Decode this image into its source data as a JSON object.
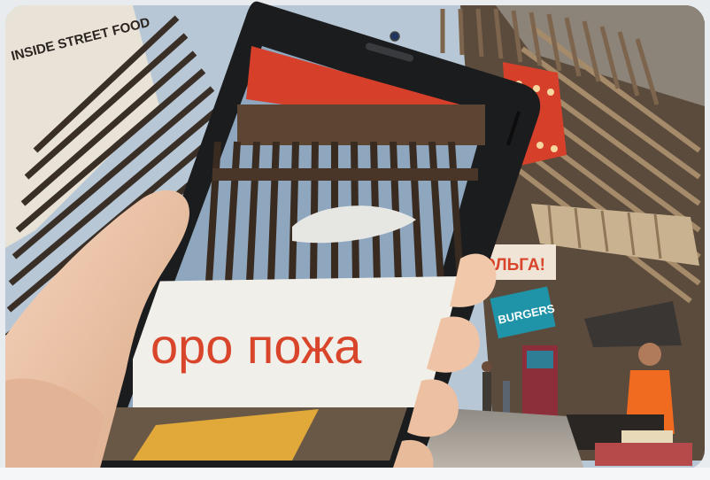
{
  "scene": {
    "subject": "hand holding smartphone in front of street food market entrance",
    "colors": {
      "wood_dark": "#3c3129",
      "wood_light": "#a78d6c",
      "sky": "#b7c7d6",
      "accent_red": "#d6402b",
      "phone_body": "#1b1c1e",
      "banner_white": "#f1efea",
      "banner_text": "#d9452b",
      "skin": "#f0c9ad",
      "apron_orange": "#f06a1f",
      "teal_sign": "#1f94a8"
    }
  },
  "signs": {
    "banner_text": "оро пожа",
    "sign_right": "ОЛЬГА!",
    "sign_teal": "BURGERS",
    "graffiti": "INSIDE STREET FOOD"
  }
}
